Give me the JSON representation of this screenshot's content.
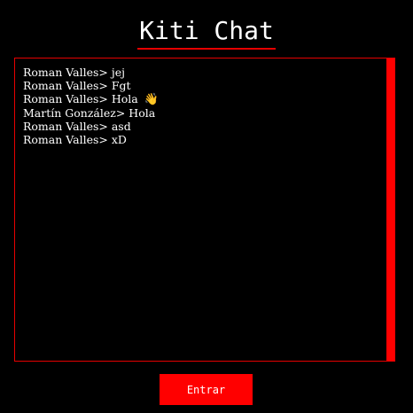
{
  "app": {
    "title": "Kiti Chat"
  },
  "chat": {
    "messages": [
      {
        "text": "Roman Valles> jej"
      },
      {
        "text": "Roman Valles> Fgt"
      },
      {
        "text": "Roman Valles> Hola",
        "emoji": "👋"
      },
      {
        "text": "Martín González> Hola"
      },
      {
        "text": "Roman Valles> asd"
      },
      {
        "text": "Roman Valles> xD"
      }
    ],
    "emoji_icon": "waving-hand-icon"
  },
  "actions": {
    "enter_label": "Entrar"
  },
  "colors": {
    "background": "#000000",
    "accent": "#ff0000",
    "text": "#ffffff"
  }
}
